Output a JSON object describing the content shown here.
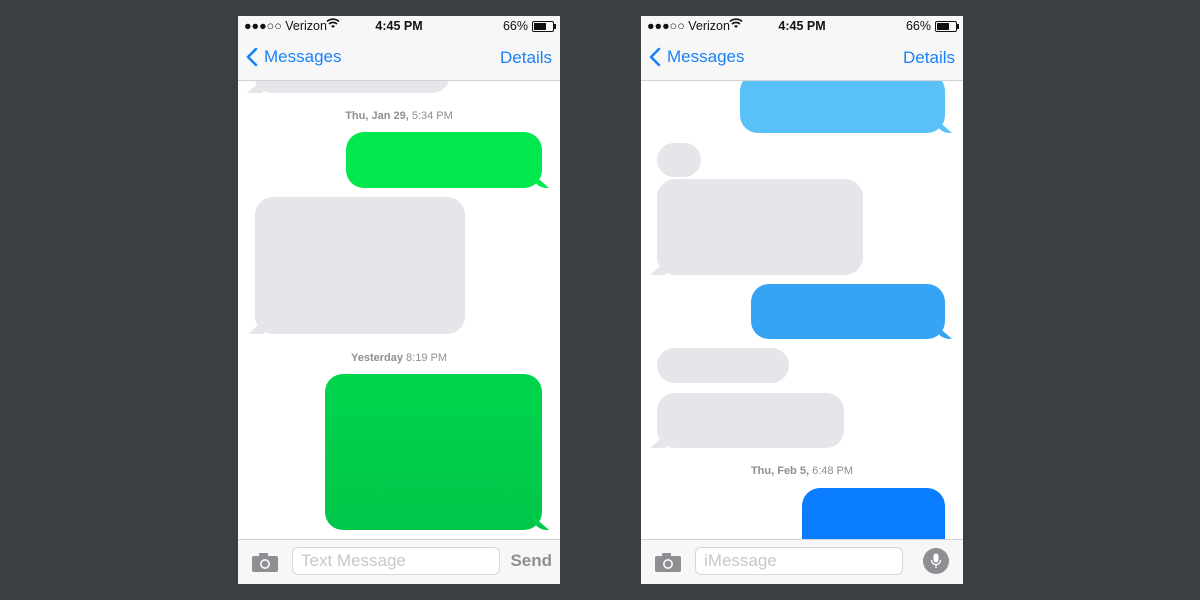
{
  "colors": {
    "background": "#3b3f42",
    "sms_green": "#00e050",
    "sms_green_dark": "#00cf4a",
    "imessage_light": "#5ac1f8",
    "imessage_mid": "#36a3f5",
    "imessage_dark": "#0a7cff",
    "received_gray": "#e5e5ea",
    "ios_blue": "#1a82f7"
  },
  "left_phone": {
    "status": {
      "carrier": "●●●○○ Verizon",
      "time": "4:45 PM",
      "battery": "66%",
      "battery_level": 0.66
    },
    "nav": {
      "back_label": "Messages",
      "details_label": "Details"
    },
    "timestamps": [
      {
        "day": "Thu, Jan 29,",
        "time": "5:34 PM"
      },
      {
        "day": "Yesterday",
        "time": "8:19 PM"
      }
    ],
    "input": {
      "placeholder": "Text Message",
      "send_label": "Send"
    }
  },
  "right_phone": {
    "status": {
      "carrier": "●●●○○ Verizon",
      "time": "4:45 PM",
      "battery": "66%",
      "battery_level": 0.66
    },
    "nav": {
      "back_label": "Messages",
      "details_label": "Details"
    },
    "timestamps": [
      {
        "day": "Thu, Feb 5,",
        "time": "6:48 PM"
      }
    ],
    "input": {
      "placeholder": "iMessage"
    }
  }
}
